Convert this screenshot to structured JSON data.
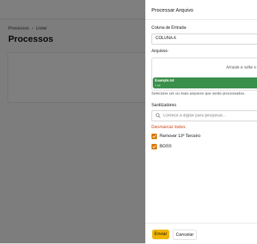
{
  "background_page": {
    "breadcrumb": [
      "Processos",
      "Listar"
    ],
    "breadcrumb_separator": "›",
    "title": "Processos"
  },
  "drawer": {
    "title": "Processar Arquivo",
    "input_column": {
      "label": "Coluna de Entrada",
      "required_marker": "*",
      "value": "COLUNA A"
    },
    "files": {
      "label": "Arquivos",
      "required_marker": "*",
      "dropzone_text": "Arraste e solte o",
      "file_name": "Example.txt",
      "file_size": "2 kB",
      "help": "Selecione um ou mais arquivos que serão processados."
    },
    "sanitizers": {
      "label": "Sanitizadores",
      "search_placeholder": "Comece a digitar para pesquisar...",
      "uncheck_all": "Desmarcar todos",
      "items": [
        {
          "label": "Remover 13º Terceiro",
          "checked": true
        },
        {
          "label": "BOSS",
          "checked": true
        }
      ]
    },
    "footer": {
      "submit": "Enviar",
      "cancel": "Cancelar"
    }
  },
  "colors": {
    "accent": "#f0b400",
    "checkbox": "#d97706",
    "link": "#c2410c",
    "file_chip": "#3a8f4b",
    "overlay": "rgba(0,0,0,0.5)"
  }
}
